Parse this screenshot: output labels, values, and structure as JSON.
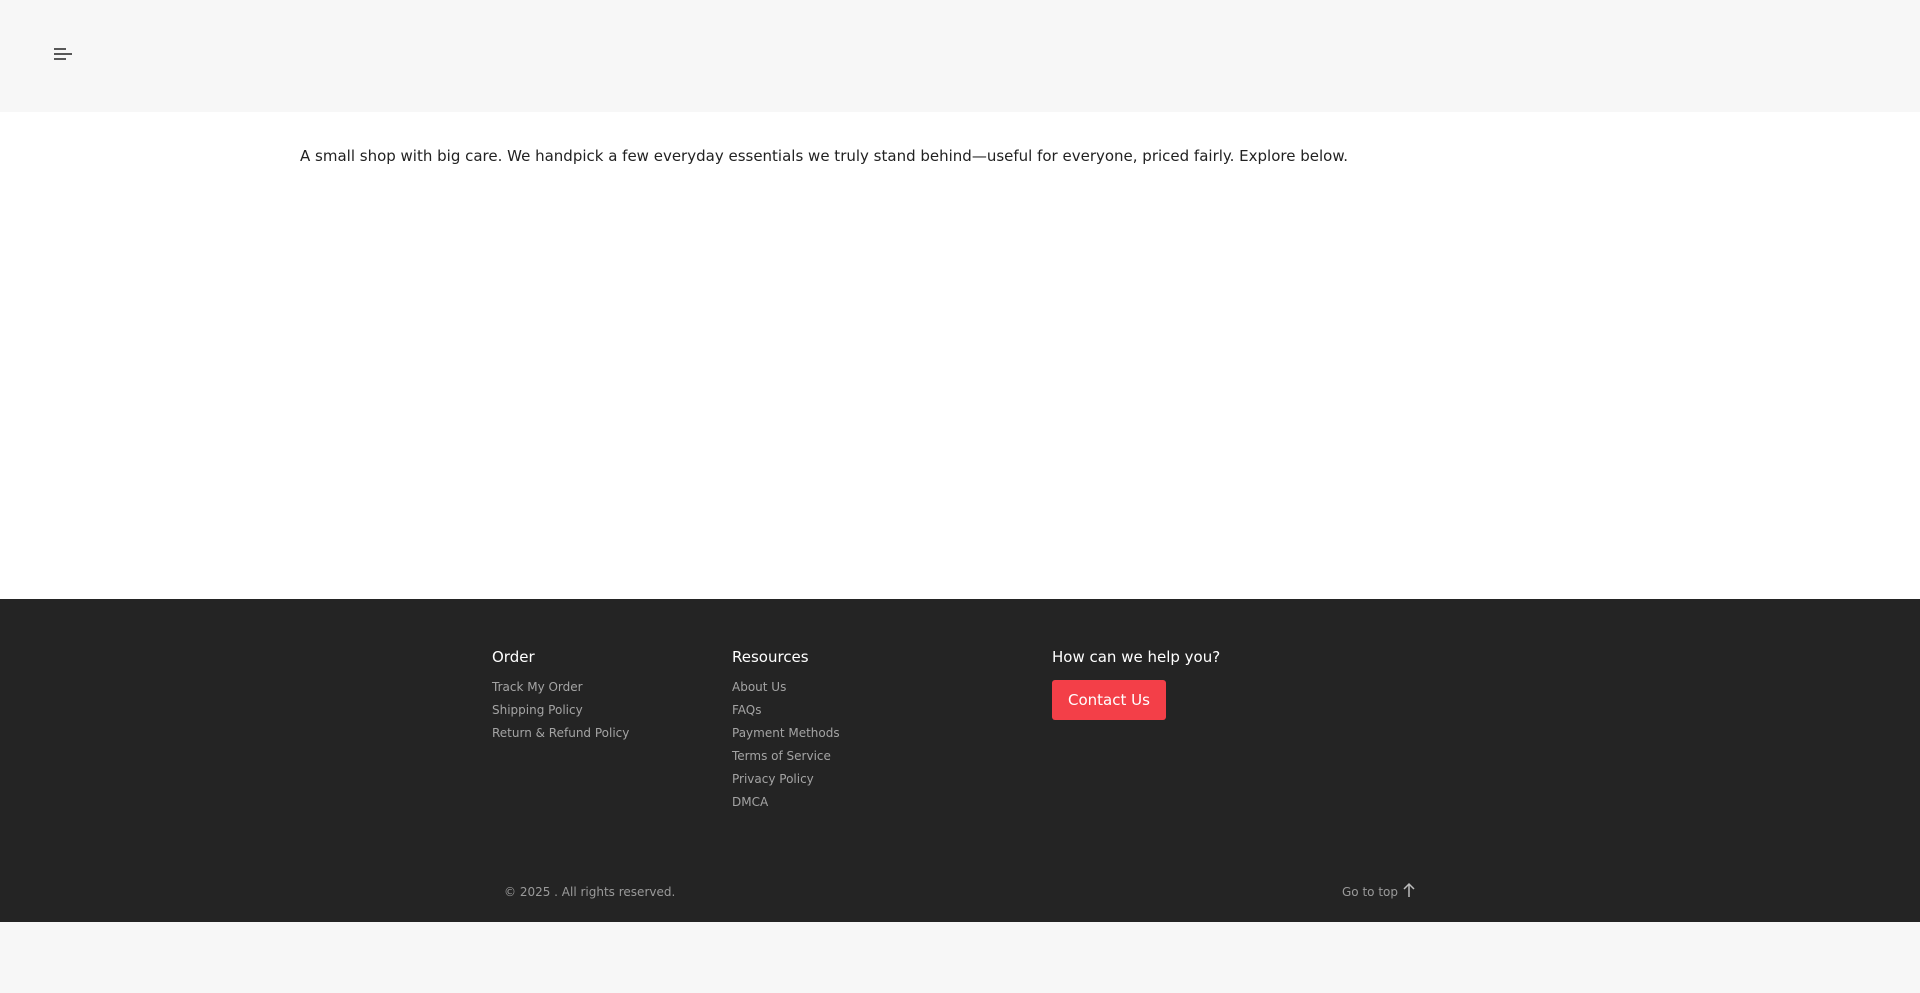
{
  "header": {
    "menu_icon": "hamburger-menu-icon"
  },
  "main": {
    "intro_text": "A small shop with big care. We handpick a few everyday essentials we truly stand behind—useful for everyone, priced fairly. Explore below."
  },
  "footer": {
    "order": {
      "heading": "Order",
      "links": [
        "Track My Order",
        "Shipping Policy",
        "Return & Refund Policy"
      ]
    },
    "resources": {
      "heading": "Resources",
      "links": [
        "About Us",
        "FAQs",
        "Payment Methods",
        "Terms of Service",
        "Privacy Policy",
        "DMCA"
      ]
    },
    "help": {
      "heading": "How can we help you?",
      "contact_label": "Contact Us"
    },
    "copyright": "© 2025 . All rights reserved.",
    "go_top_label": "Go to top",
    "go_top_icon": "arrow-up-icon"
  },
  "colors": {
    "header_bg": "#f7f7f7",
    "main_bg": "#ffffff",
    "footer_bg": "#242424",
    "accent": "#f33f48",
    "footer_link": "#a4a4a4"
  }
}
